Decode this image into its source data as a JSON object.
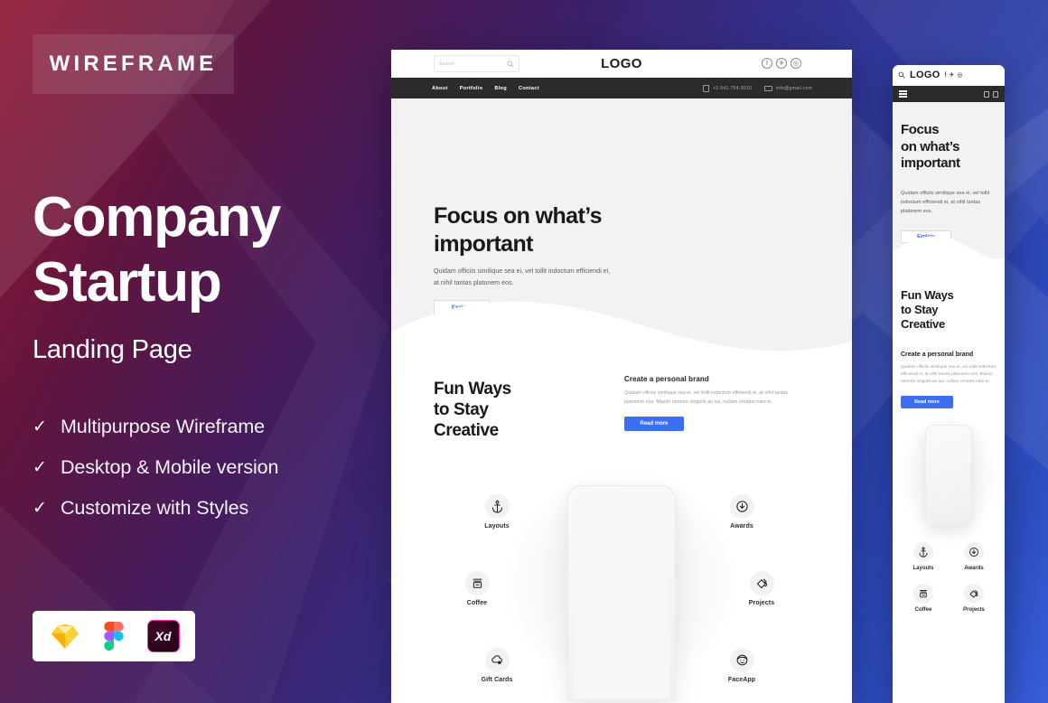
{
  "left_panel": {
    "badge": "WIREFRAME",
    "title_line1": "Company",
    "title_line2": "Startup",
    "subtitle": "Landing Page",
    "features": [
      {
        "check": "✓",
        "label": "Multipurpose Wireframe"
      },
      {
        "check": "✓",
        "label": "Desktop & Mobile version"
      },
      {
        "check": "✓",
        "label": "Customize with Styles"
      }
    ],
    "logos": [
      {
        "name": "sketch-logo",
        "label": "Sketch"
      },
      {
        "name": "figma-logo",
        "label": "Figma"
      },
      {
        "name": "adobe-xd-logo",
        "label": "Xd"
      }
    ],
    "colors": {
      "gradient_start": "#8b0f2e",
      "gradient_mid": "#3b2470",
      "gradient_end": "#3a62e0",
      "badge_bg": "rgba(255,255,255,0.10)",
      "text": "#ffffff"
    }
  },
  "desktop": {
    "search": {
      "placeholder": "Search",
      "icon": "search-icon"
    },
    "logo": "LOGO",
    "social": [
      {
        "name": "facebook-icon",
        "glyph": "f"
      },
      {
        "name": "twitter-icon",
        "glyph": "✈"
      },
      {
        "name": "instagram-icon",
        "glyph": "◎"
      }
    ],
    "nav": [
      "About",
      "Portfolio",
      "Blog",
      "Contact"
    ],
    "contact": {
      "phone_icon": "phone-icon",
      "phone": "+1-541-754-3010",
      "mail_icon": "mail-icon",
      "email": "info@gmail.com"
    },
    "hero": {
      "heading_line1": "Focus on what’s",
      "heading_line2": "important",
      "paragraph": "Quidam officiis similique sea ei, vel tollit indoctum efficiendi ei, at nihil tantas platonem eos.",
      "cta": "Explore"
    },
    "section2": {
      "heading_line1": "Fun Ways",
      "heading_line2": "to Stay",
      "heading_line3": "Creative",
      "card_title": "Create a personal brand",
      "card_paragraph": "Quidam officiis similique sea ei, vel tollit indoctum efficiendi ei, at nihil tantas platonem eos. Maxim nemore singulis an ius, nullam ornatus nam ei.",
      "card_cta": "Read more"
    },
    "feature_icons": [
      {
        "icon": "anchor-icon",
        "label": "Layouts"
      },
      {
        "icon": "award-icon",
        "label": "Awards"
      },
      {
        "icon": "coffee-icon",
        "label": "Coffee"
      },
      {
        "icon": "paint-icon",
        "label": "Projects"
      },
      {
        "icon": "gift-card-icon",
        "label": "Gift Cards"
      },
      {
        "icon": "face-icon",
        "label": "FaceApp"
      }
    ],
    "colors": {
      "nav_bg": "#2b2b2b",
      "hero_bg": "#f2f2f2",
      "primary": "#3b6ef0",
      "link": "#2c5fe0"
    }
  },
  "mobile": {
    "search_icon": "search-icon",
    "logo": "LOGO",
    "social": [
      {
        "name": "facebook-icon",
        "glyph": "f"
      },
      {
        "name": "twitter-icon",
        "glyph": "✈"
      },
      {
        "name": "instagram-icon",
        "glyph": "◎"
      }
    ],
    "menu_icon": "hamburger-menu-icon",
    "hero": {
      "heading_line1": "Focus",
      "heading_line2": "on what’s",
      "heading_line3": "important",
      "paragraph": "Quidam officiis similique sea ei, vel tollit indoctum efficiendi ei, at nihil tantas platonem eos.",
      "cta": "Explore"
    },
    "section2": {
      "heading_line1": "Fun Ways",
      "heading_line2": "to Stay",
      "heading_line3": "Creative",
      "card_title": "Create a personal brand",
      "card_paragraph": "Quidam officiis similique sea ei, vel tollit indoctum efficiendi ei, at nihil tantas platonem eos. Maxim nemore singulis an ius, nullam ornatus nam ei.",
      "card_cta": "Read more"
    },
    "feature_icons": [
      {
        "icon": "anchor-icon",
        "label": "Layouts"
      },
      {
        "icon": "award-icon",
        "label": "Awards"
      },
      {
        "icon": "coffee-icon",
        "label": "Coffee"
      },
      {
        "icon": "paint-icon",
        "label": "Projects"
      }
    ]
  }
}
